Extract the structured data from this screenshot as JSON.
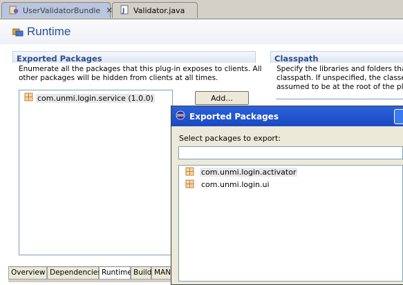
{
  "editor_tabs": [
    {
      "label": "UserValidatorBundle",
      "icon": "plugin-manifest-icon",
      "active": true
    },
    {
      "label": "Validator.java",
      "icon": "java-file-icon",
      "active": false
    }
  ],
  "page": {
    "title": "Runtime",
    "icon": "runtime-icon"
  },
  "exported_packages": {
    "title": "Exported Packages",
    "description_line1": "Enumerate all the packages that this plug-in exposes to clients.  All",
    "description_line2": "other packages will be hidden from clients at all times.",
    "items": [
      "com.unmi.login.service (1.0.0)"
    ],
    "add_label": "Add..."
  },
  "classpath": {
    "title": "Classpath",
    "description_line1": "Specify the libraries and folders that c",
    "description_line2": "classpath.  If unspecified, the classes",
    "description_line3": "assumed to be at the root of the plug-"
  },
  "page_tabs": [
    "Overview",
    "Dependencies",
    "Runtime",
    "Build",
    "MAN"
  ],
  "dialog": {
    "title": "Exported Packages",
    "prompt": "Select packages to export:",
    "filter_value": "",
    "items": [
      "com.unmi.login.activator",
      "com.unmi.login.ui"
    ]
  },
  "colors": {
    "accent": "#2a4c9a",
    "dialog_title_bar": "#1f55cf",
    "package_icon": "#c8803a"
  }
}
